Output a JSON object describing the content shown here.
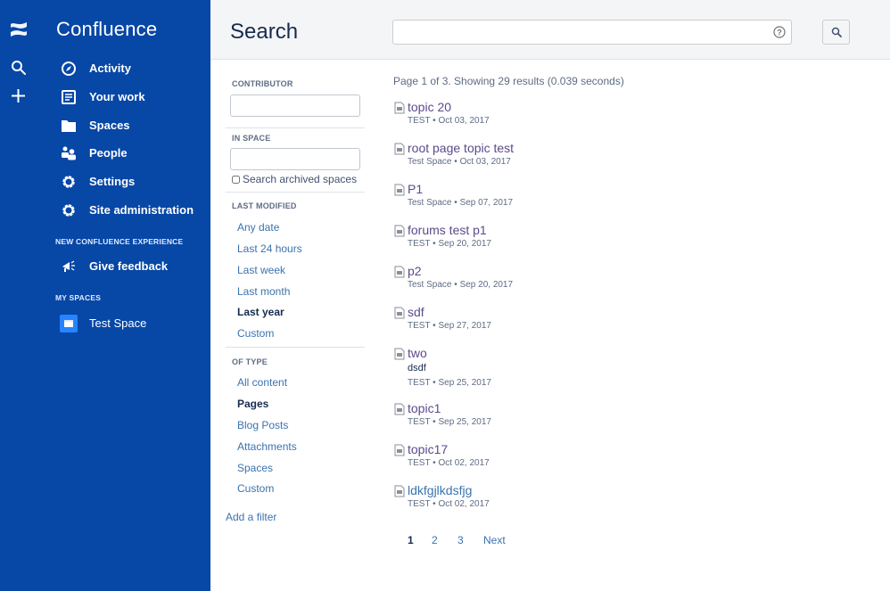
{
  "nav": {
    "app_title": "Confluence",
    "rail": {
      "logo_icon": "confluence-logo-icon",
      "search_icon": "search-icon",
      "create_icon": "plus-icon"
    },
    "items": [
      {
        "label": "Activity",
        "icon": "compass-icon"
      },
      {
        "label": "Your work",
        "icon": "document-icon"
      },
      {
        "label": "Spaces",
        "icon": "folder-icon"
      },
      {
        "label": "People",
        "icon": "people-icon"
      },
      {
        "label": "Settings",
        "icon": "gear-icon"
      },
      {
        "label": "Site administration",
        "icon": "gear-icon"
      }
    ],
    "new_experience_heading": "NEW CONFLUENCE EXPERIENCE",
    "feedback": {
      "label": "Give feedback",
      "icon": "megaphone-icon"
    },
    "my_spaces_heading": "MY SPACES",
    "spaces": [
      {
        "label": "Test Space",
        "icon": "space-icon"
      }
    ]
  },
  "header": {
    "title": "Search",
    "search": {
      "value": "",
      "placeholder": ""
    },
    "help_icon": "help-icon",
    "search_button_icon": "search-icon"
  },
  "filters": {
    "contributor": {
      "heading": "CONTRIBUTOR",
      "value": ""
    },
    "in_space": {
      "heading": "IN SPACE",
      "value": "",
      "archived_label": "Search archived spaces",
      "archived_checked": false
    },
    "last_modified": {
      "heading": "LAST MODIFIED",
      "options": [
        "Any date",
        "Last 24 hours",
        "Last week",
        "Last month",
        "Last year",
        "Custom"
      ],
      "selected": "Last year"
    },
    "of_type": {
      "heading": "OF TYPE",
      "options": [
        "All content",
        "Pages",
        "Blog Posts",
        "Attachments",
        "Spaces",
        "Custom"
      ],
      "selected": "Pages"
    },
    "add_filter": "Add a filter"
  },
  "results": {
    "summary": "Page 1 of 3. Showing 29 results (0.039 seconds)",
    "items": [
      {
        "title": "topic 20",
        "excerpt": "",
        "space": "TEST",
        "date": "Oct 03, 2017",
        "visited": true
      },
      {
        "title": "root page topic test",
        "excerpt": "",
        "space": "Test Space",
        "date": "Oct 03, 2017",
        "visited": true
      },
      {
        "title": "P1",
        "excerpt": "",
        "space": "Test Space",
        "date": "Sep 07, 2017",
        "visited": true
      },
      {
        "title": "forums test p1",
        "excerpt": "",
        "space": "TEST",
        "date": "Sep 20, 2017",
        "visited": true
      },
      {
        "title": "p2",
        "excerpt": "",
        "space": "Test Space",
        "date": "Sep 20, 2017",
        "visited": true
      },
      {
        "title": "sdf",
        "excerpt": "",
        "space": "TEST",
        "date": "Sep 27, 2017",
        "visited": true
      },
      {
        "title": "two",
        "excerpt": "dsdf",
        "space": "TEST",
        "date": "Sep 25, 2017",
        "visited": true
      },
      {
        "title": "topic1",
        "excerpt": "",
        "space": "TEST",
        "date": "Sep 25, 2017",
        "visited": true
      },
      {
        "title": "topic17",
        "excerpt": "",
        "space": "TEST",
        "date": "Oct 02, 2017",
        "visited": true
      },
      {
        "title": "ldkfgjlkdsfjg",
        "excerpt": "",
        "space": "TEST",
        "date": "Oct 02, 2017",
        "visited": false
      }
    ],
    "meta_separator": "•",
    "pagination": {
      "pages": [
        "1",
        "2",
        "3"
      ],
      "current": "1",
      "next_label": "Next"
    }
  },
  "colors": {
    "nav_bg": "#0747a6",
    "link": "#3b73af",
    "visited_link": "#5c4a8c",
    "space_icon": "#2684ff"
  }
}
